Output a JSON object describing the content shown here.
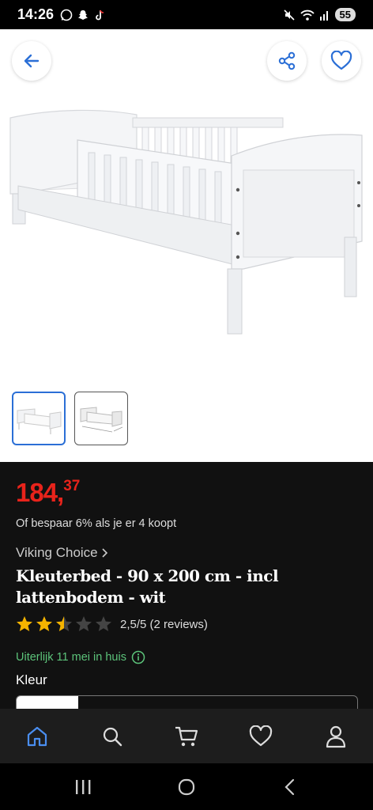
{
  "status_bar": {
    "time": "14:26",
    "battery": "55"
  },
  "product": {
    "price_main": "184,",
    "price_cents": "37",
    "bulk_offer": "Of bespaar 6% als je er 4 koopt",
    "brand": "Viking Choice",
    "title": "Kleuterbed - 90 x 200 cm - incl lattenbodem - wit",
    "rating": 2.5,
    "rating_text": "2,5/5 (2 reviews)",
    "delivery": "Uiterlijk 11 mei in huis",
    "color_label": "Kleur"
  },
  "icons": {
    "back": "arrow-left-icon",
    "share": "share-icon",
    "favorite": "heart-icon",
    "info": "info-icon"
  },
  "colors": {
    "accent_blue": "#2b6fd6",
    "price_red": "#e8231b",
    "delivery_green": "#5cc37a"
  },
  "bottom_nav": [
    "home-icon",
    "search-icon",
    "cart-icon",
    "heart-icon",
    "account-icon"
  ]
}
